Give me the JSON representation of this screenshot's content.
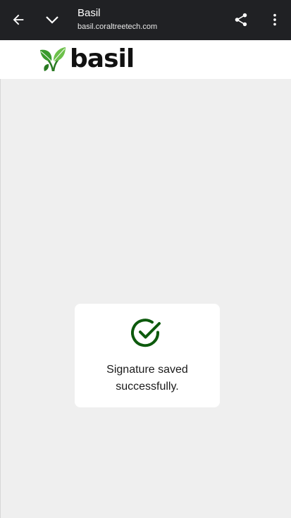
{
  "browser": {
    "page_title": "Basil",
    "url": "basil.coraltreetech.com",
    "icons": {
      "back": "arrow-left-icon",
      "collapse": "chevron-down-icon",
      "share": "share-icon",
      "more": "more-vertical-icon"
    }
  },
  "site": {
    "logo_text": "basil",
    "logo_icon": "leaf-icon",
    "brand_color": "#3a9a2e"
  },
  "dialog": {
    "icon": "check-circle-icon",
    "icon_color": "#0d5a0d",
    "message": "Signature saved successfully."
  }
}
